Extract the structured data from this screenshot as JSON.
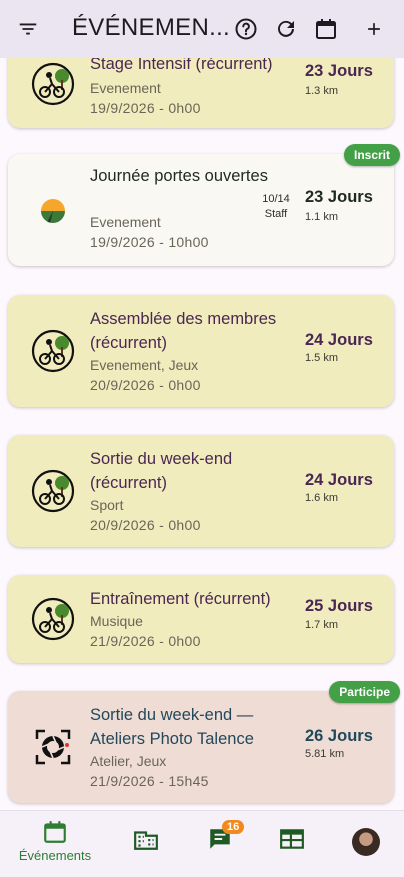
{
  "appbar": {
    "title": "ÉVÉNEMEN...",
    "icons": [
      "filter-icon",
      "help-icon",
      "refresh-icon",
      "calendar-icon",
      "add-icon"
    ]
  },
  "cards": [
    {
      "title": "Stage Intensif (récurrent)",
      "category": "Evenement",
      "date": "19/9/2026 - 0h00",
      "days": "23 Jours",
      "km": "1.3 km",
      "color": "#f1ecbd",
      "icon": "cyclist-logo-icon"
    },
    {
      "title": "Journée portes ouvertes",
      "category": "Evenement",
      "date": "19/9/2026 - 10h00",
      "days": "23 Jours",
      "km": "1.1 km",
      "staff_count": "10/14",
      "staff_label": "Staff",
      "badge": "Inscrit",
      "color": "#f9f8f3",
      "icon": "sunset-road-icon"
    },
    {
      "title": "Assemblée des membres (récurrent)",
      "category": "Evenement, Jeux",
      "date": "20/9/2026 - 0h00",
      "days": "24 Jours",
      "km": "1.5 km",
      "color": "#f1ecbd",
      "icon": "cyclist-logo-icon"
    },
    {
      "title": "Sortie du week-end (récurrent)",
      "category": "Sport",
      "date": "20/9/2026 - 0h00",
      "days": "24 Jours",
      "km": "1.6 km",
      "color": "#f1ecbd",
      "icon": "cyclist-logo-icon"
    },
    {
      "title": "Entraînement (récurrent)",
      "category": "Musique",
      "date": "21/9/2026 - 0h00",
      "days": "25 Jours",
      "km": "1.7 km",
      "color": "#f1ecbd",
      "icon": "cyclist-logo-icon"
    },
    {
      "title": "Sortie du week-end — Ateliers Photo Talence",
      "category": "Atelier, Jeux",
      "date": "21/9/2026 - 15h45",
      "days": "26 Jours",
      "km": "5.81 km",
      "badge": "Participe",
      "color": "#efddd5",
      "icon": "camera-aperture-icon"
    }
  ],
  "bottomnav": {
    "events_label": "Événements",
    "messages_badge": "16",
    "accent": "#2e7d32"
  }
}
